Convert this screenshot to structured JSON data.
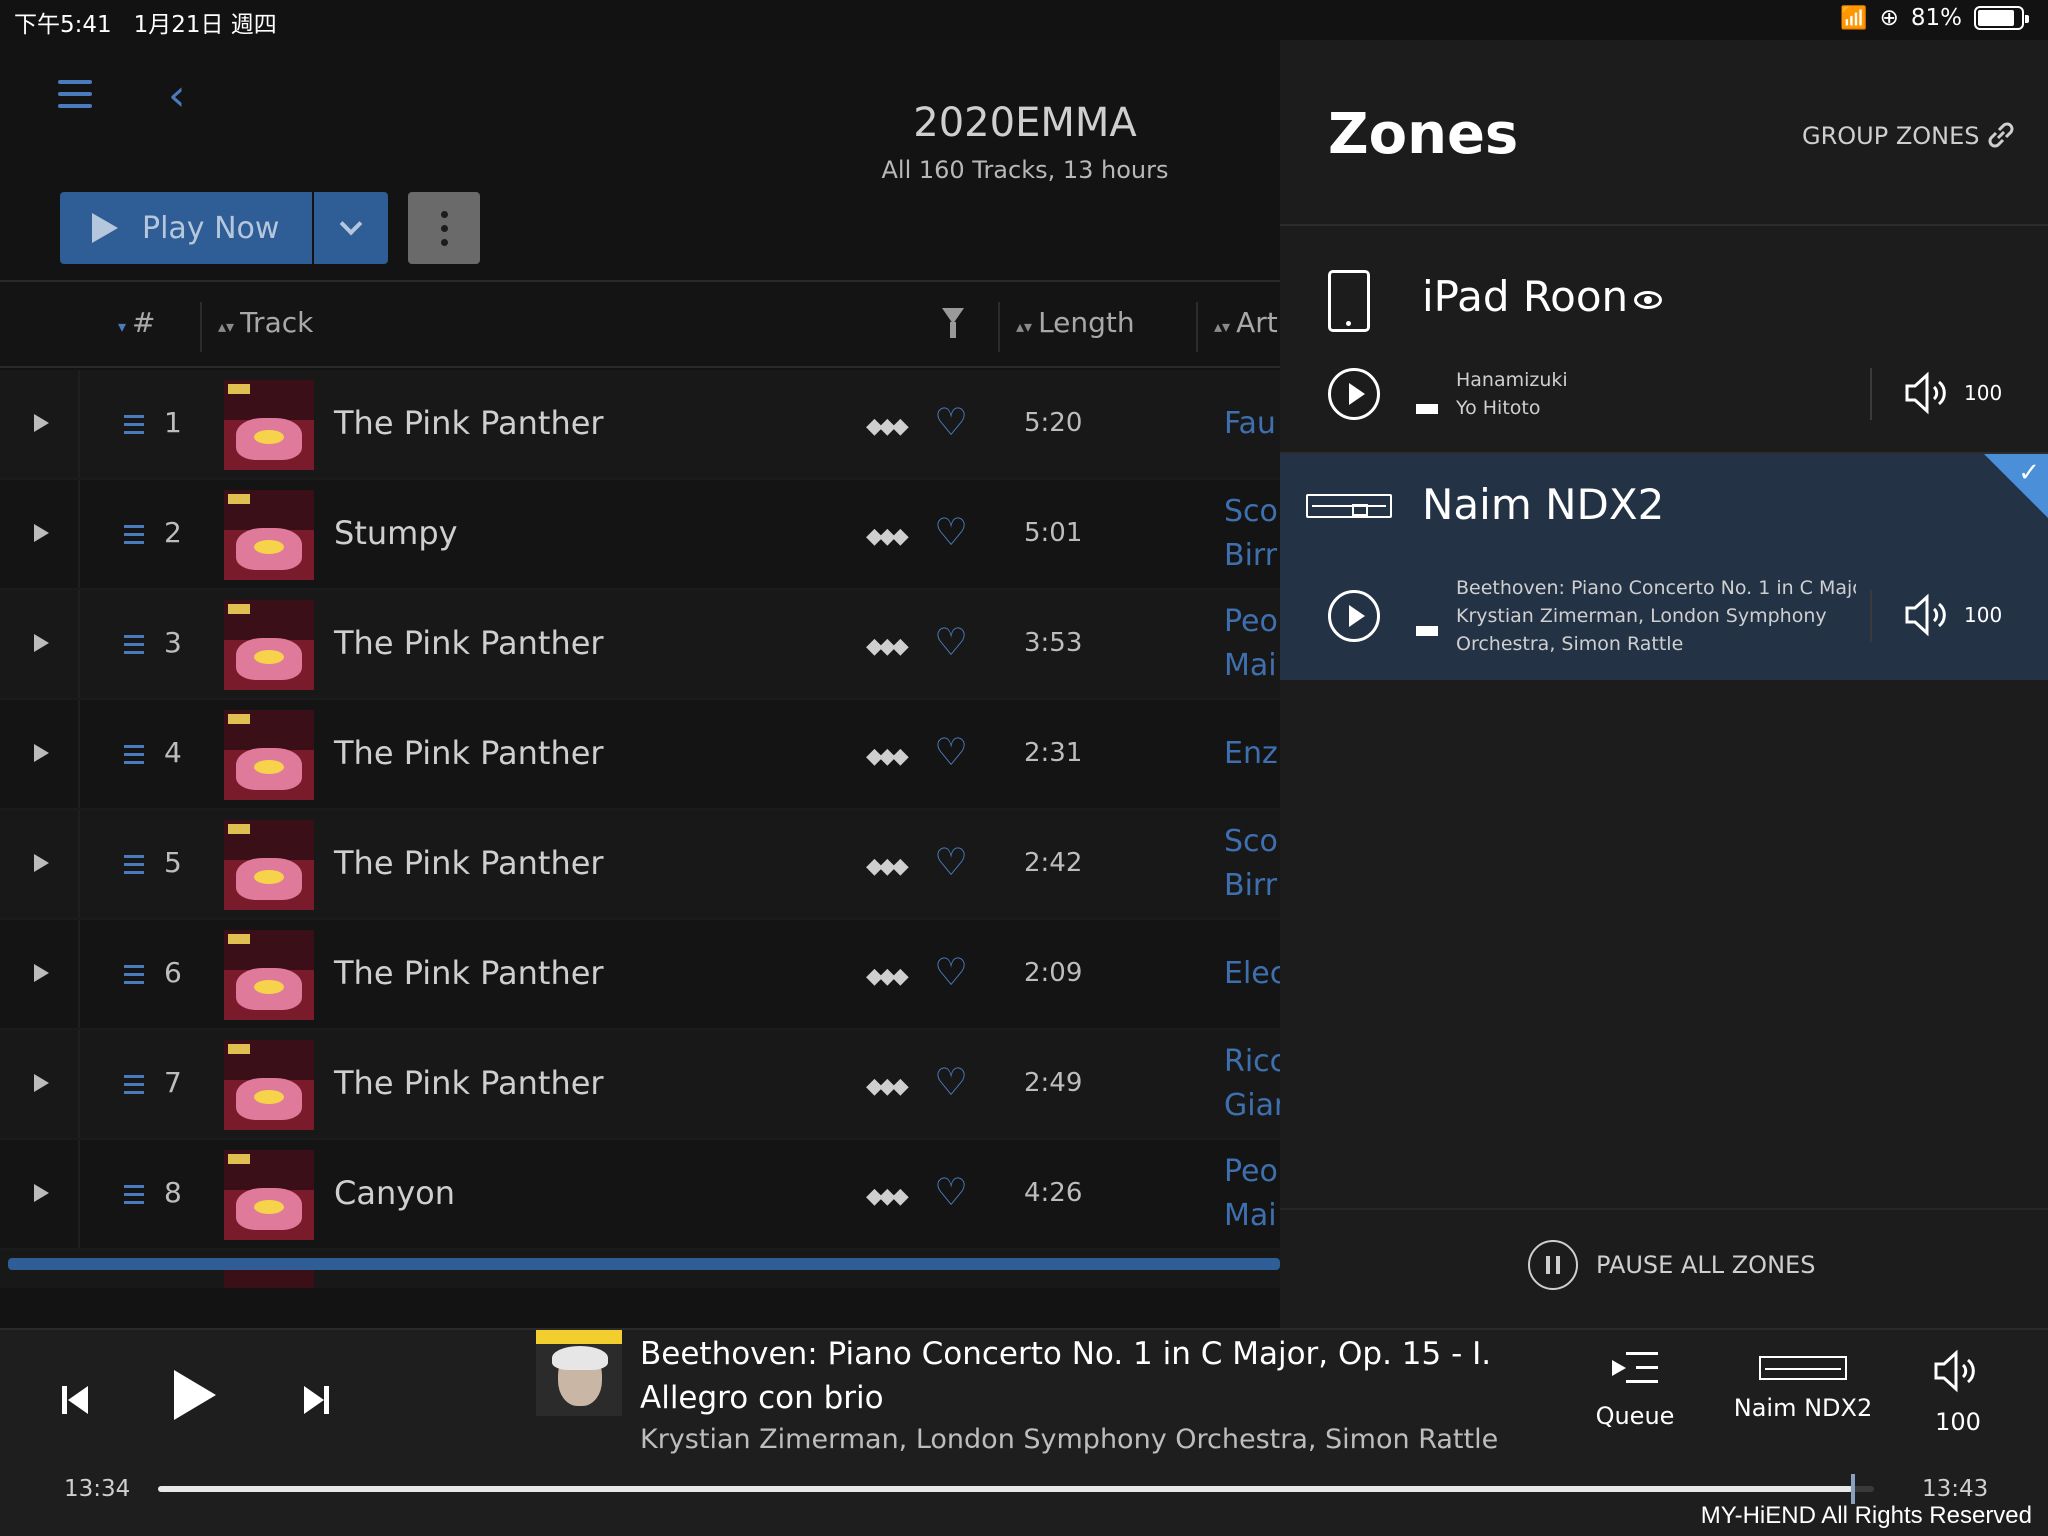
{
  "status_bar": {
    "time_date": "下午5:41   1月21日 週四",
    "battery": "81%"
  },
  "album": {
    "title": "2020EMMA",
    "subtitle": "All 160 Tracks, 13 hours",
    "play_now": "Play Now"
  },
  "table": {
    "headers": {
      "num": "#",
      "track": "Track",
      "length": "Length",
      "artist": "Art"
    },
    "rows": [
      {
        "num": "1",
        "title": "The Pink Panther",
        "length": "5:20",
        "artist1": "Fau",
        "artist2": ""
      },
      {
        "num": "2",
        "title": "Stumpy",
        "length": "5:01",
        "artist1": "Sco",
        "artist2": "Birr"
      },
      {
        "num": "3",
        "title": "The Pink Panther",
        "length": "3:53",
        "artist1": "Peo",
        "artist2": "Mai"
      },
      {
        "num": "4",
        "title": "The Pink Panther",
        "length": "2:31",
        "artist1": "Enz",
        "artist2": ""
      },
      {
        "num": "5",
        "title": "The Pink Panther",
        "length": "2:42",
        "artist1": "Sco",
        "artist2": "Birr"
      },
      {
        "num": "6",
        "title": "The Pink Panther",
        "length": "2:09",
        "artist1": "Elec",
        "artist2": ""
      },
      {
        "num": "7",
        "title": "The Pink Panther",
        "length": "2:49",
        "artist1": "Ricc",
        "artist2": "Giar"
      },
      {
        "num": "8",
        "title": "Canyon",
        "length": "4:26",
        "artist1": "Peo",
        "artist2": "Mai"
      }
    ]
  },
  "zones": {
    "title": "Zones",
    "group_zones": "GROUP ZONES",
    "zone1": {
      "name": "iPad Roon",
      "line1": "Hanamizuki",
      "line2": "Yo Hitoto",
      "volume": "100"
    },
    "zone2": {
      "name": "Naim NDX2",
      "line1": "Beethoven: Piano Concerto No. 1 in C Majo",
      "line2": "Krystian Zimerman, London Symphony",
      "line3": "Orchestra, Simon Rattle",
      "volume": "100",
      "selected": true
    },
    "pause_all": "PAUSE ALL ZONES"
  },
  "player": {
    "title": "Beethoven: Piano Concerto No. 1 in C Major, Op. 15 - I. Allegro con brio",
    "artist": "Krystian Zimerman, London Symphony Orchestra, Simon Rattle",
    "queue_label": "Queue",
    "zone_label": "Naim NDX2",
    "volume_label": "100",
    "elapsed": "13:34",
    "total": "13:43",
    "progress": 0.988
  },
  "watermark": "MY-HiEND All Rights Reserved",
  "colors": {
    "accent": "#4a7bbd",
    "button": "#2f5d95",
    "selected_zone": "#243246",
    "check": "#4a8fd8"
  }
}
